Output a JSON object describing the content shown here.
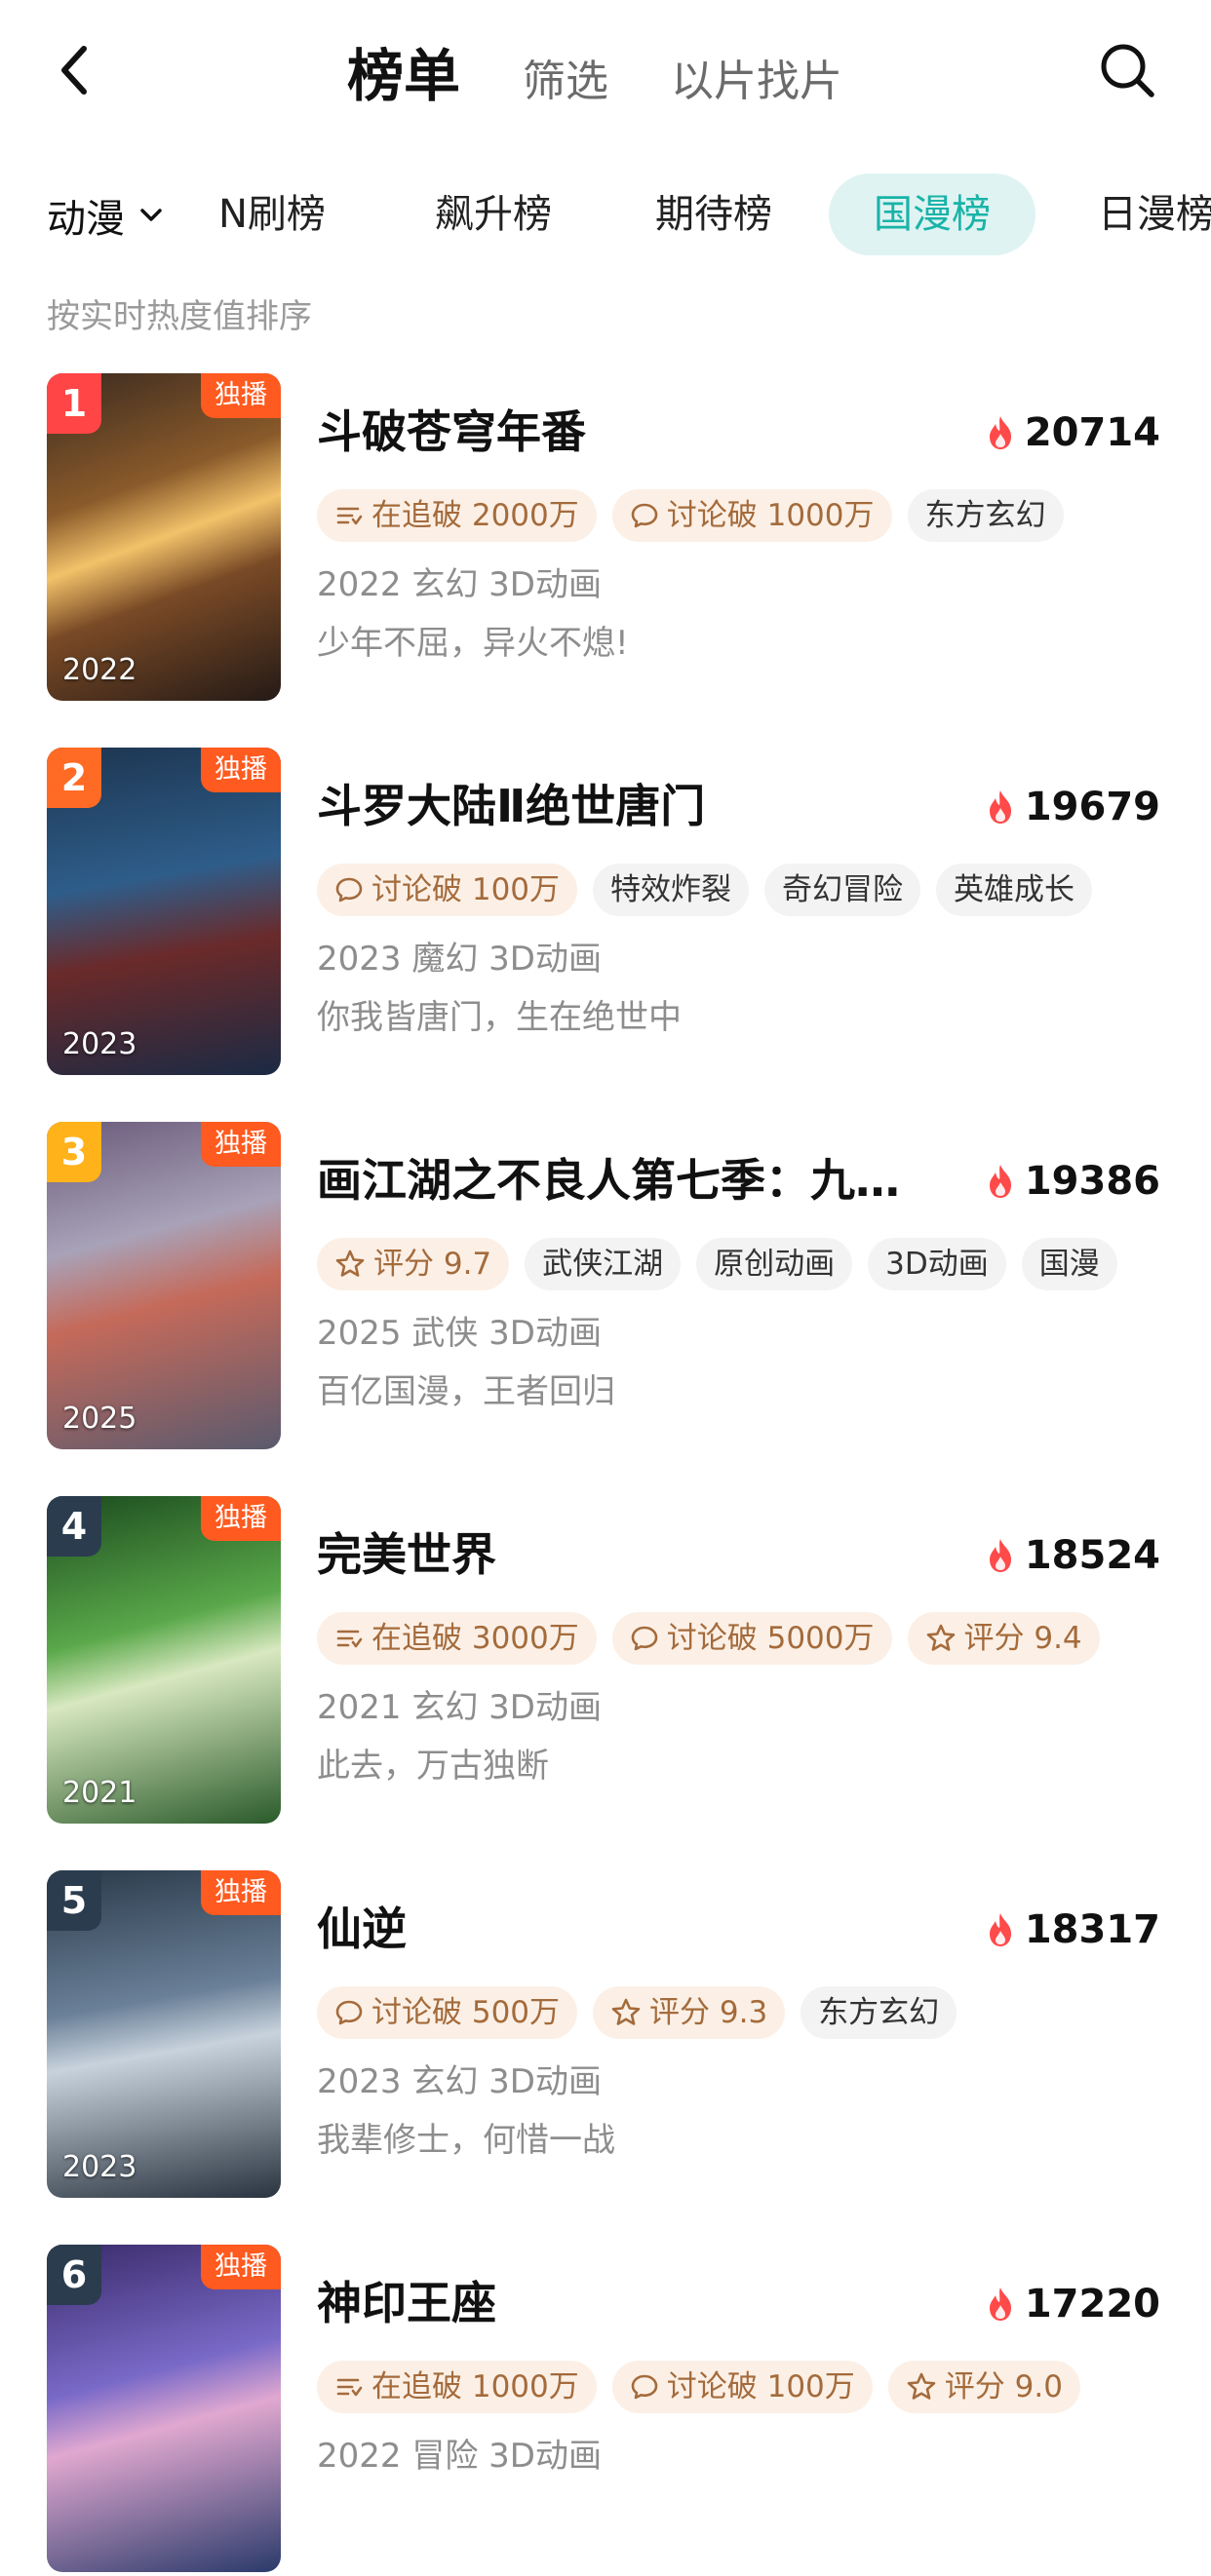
{
  "header": {
    "tabs": [
      {
        "label": "榜单",
        "active": true
      },
      {
        "label": "筛选",
        "active": false
      },
      {
        "label": "以片找片",
        "active": false
      }
    ],
    "back_icon": "chevron-left-icon",
    "search_icon": "search-icon"
  },
  "category": {
    "selected": "动漫",
    "tabs": [
      {
        "label": "N刷榜",
        "active": false
      },
      {
        "label": "飙升榜",
        "active": false
      },
      {
        "label": "期待榜",
        "active": false
      },
      {
        "label": "国漫榜",
        "active": true
      },
      {
        "label": "日漫榜",
        "active": false
      }
    ]
  },
  "sort_label": "按实时热度值排序",
  "colors": {
    "accent": "#19b3a8",
    "accent_bg": "#dff3f2",
    "exclusive": "#ff5a1f",
    "flame": "#ff4a4a",
    "rank_1": "#ff4545",
    "rank_2": "#ff6a24",
    "rank_3": "#ffb21a",
    "rank_other": "#2b3c4f"
  },
  "items": [
    {
      "rank": "1",
      "badge": "独播",
      "poster_year": "2022",
      "title": "斗破苍穹年番",
      "heat": "20714",
      "tags": [
        {
          "icon": "list-icon",
          "text": "在追破 2000万",
          "style": "hot"
        },
        {
          "icon": "comment-icon",
          "text": "讨论破 1000万",
          "style": "hot"
        },
        {
          "icon": "",
          "text": "东方玄幻",
          "style": "plain"
        }
      ],
      "meta": "2022 玄幻 3D动画",
      "desc": "少年不屈，异火不熄!"
    },
    {
      "rank": "2",
      "badge": "独播",
      "poster_year": "2023",
      "title": "斗罗大陆Ⅱ绝世唐门",
      "heat": "19679",
      "tags": [
        {
          "icon": "comment-icon",
          "text": "讨论破 100万",
          "style": "hot"
        },
        {
          "icon": "",
          "text": "特效炸裂",
          "style": "plain"
        },
        {
          "icon": "",
          "text": "奇幻冒险",
          "style": "plain"
        },
        {
          "icon": "",
          "text": "英雄成长",
          "style": "plain"
        }
      ],
      "meta": "2023 魔幻 3D动画",
      "desc": "你我皆唐门，生在绝世中"
    },
    {
      "rank": "3",
      "badge": "独播",
      "poster_year": "2025",
      "title": "画江湖之不良人第七季：九…",
      "heat": "19386",
      "tags": [
        {
          "icon": "star-icon",
          "text": "评分 9.7",
          "style": "hot"
        },
        {
          "icon": "",
          "text": "武侠江湖",
          "style": "plain"
        },
        {
          "icon": "",
          "text": "原创动画",
          "style": "plain"
        },
        {
          "icon": "",
          "text": "3D动画",
          "style": "plain"
        },
        {
          "icon": "",
          "text": "国漫",
          "style": "plain"
        }
      ],
      "meta": "2025 武侠 3D动画",
      "desc": "百亿国漫，王者回归"
    },
    {
      "rank": "4",
      "badge": "独播",
      "poster_year": "2021",
      "title": "完美世界",
      "heat": "18524",
      "tags": [
        {
          "icon": "list-icon",
          "text": "在追破 3000万",
          "style": "hot"
        },
        {
          "icon": "comment-icon",
          "text": "讨论破 5000万",
          "style": "hot"
        },
        {
          "icon": "star-icon",
          "text": "评分 9.4",
          "style": "hot"
        }
      ],
      "meta": "2021 玄幻 3D动画",
      "desc": "此去，万古独断"
    },
    {
      "rank": "5",
      "badge": "独播",
      "poster_year": "2023",
      "title": "仙逆",
      "heat": "18317",
      "tags": [
        {
          "icon": "comment-icon",
          "text": "讨论破 500万",
          "style": "hot"
        },
        {
          "icon": "star-icon",
          "text": "评分 9.3",
          "style": "hot"
        },
        {
          "icon": "",
          "text": "东方玄幻",
          "style": "plain"
        }
      ],
      "meta": "2023 玄幻 3D动画",
      "desc": "我辈修士，何惜一战"
    },
    {
      "rank": "6",
      "badge": "独播",
      "poster_year": "",
      "title": "神印王座",
      "heat": "17220",
      "tags": [
        {
          "icon": "list-icon",
          "text": "在追破 1000万",
          "style": "hot"
        },
        {
          "icon": "comment-icon",
          "text": "讨论破 100万",
          "style": "hot"
        },
        {
          "icon": "star-icon",
          "text": "评分 9.0",
          "style": "hot"
        }
      ],
      "meta": "2022 冒险 3D动画",
      "desc": ""
    }
  ]
}
